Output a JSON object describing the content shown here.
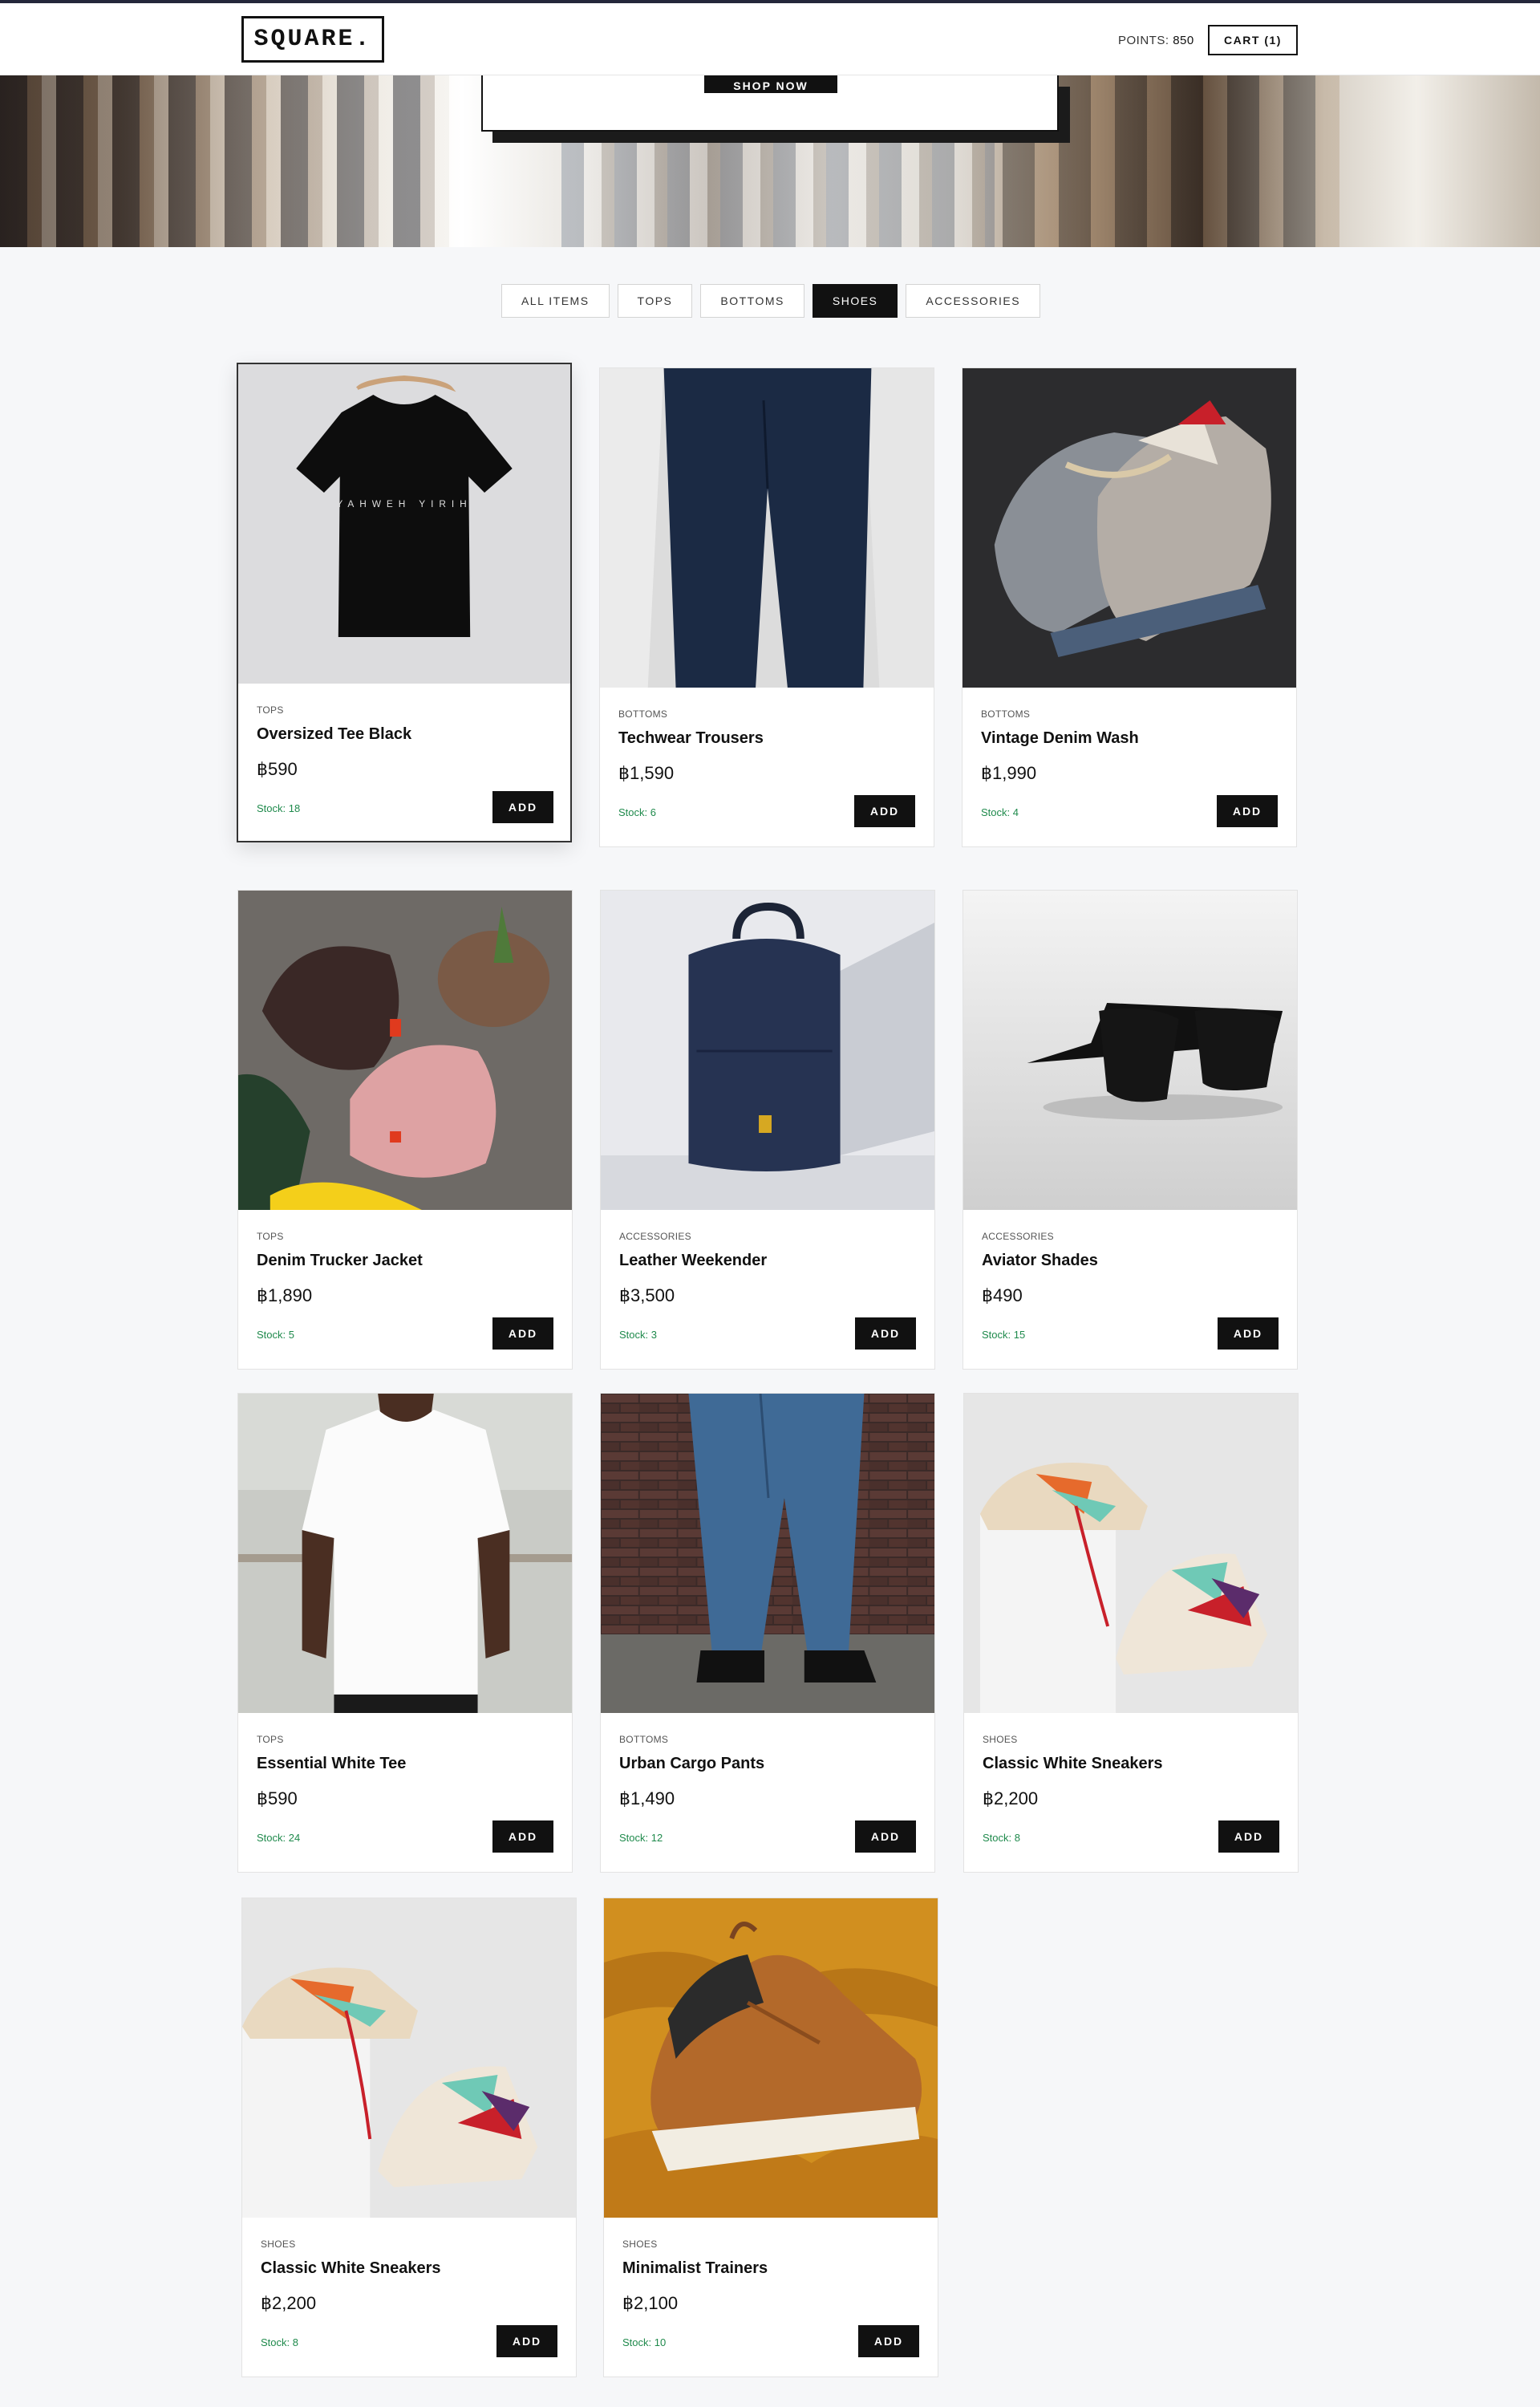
{
  "header": {
    "logo": "SQUARE.",
    "points_label": "POINTS:",
    "points_value": "850",
    "cart_label": "CART (1)"
  },
  "hero": {
    "cta_label": "SHOP NOW"
  },
  "filters": [
    {
      "label": "ALL ITEMS",
      "active": false
    },
    {
      "label": "TOPS",
      "active": false
    },
    {
      "label": "BOTTOMS",
      "active": false
    },
    {
      "label": "SHOES",
      "active": true
    },
    {
      "label": "ACCESSORIES",
      "active": false
    }
  ],
  "products": [
    {
      "category": "TOPS",
      "name": "Oversized Tee Black",
      "price": "฿590",
      "stock": "Stock: 18",
      "add_label": "ADD",
      "image": "black-tshirt-image"
    },
    {
      "category": "BOTTOMS",
      "name": "Techwear Trousers",
      "price": "฿1,590",
      "stock": "Stock: 6",
      "add_label": "ADD",
      "image": "navy-trousers-image"
    },
    {
      "category": "BOTTOMS",
      "name": "Vintage Denim Wash",
      "price": "฿1,990",
      "stock": "Stock: 4",
      "add_label": "ADD",
      "image": "grey-sneakers-image"
    },
    {
      "category": "TOPS",
      "name": "Denim Trucker Jacket",
      "price": "฿1,890",
      "stock": "Stock: 5",
      "add_label": "ADD",
      "image": "beanies-image"
    },
    {
      "category": "ACCESSORIES",
      "name": "Leather Weekender",
      "price": "฿3,500",
      "stock": "Stock: 3",
      "add_label": "ADD",
      "image": "backpack-image"
    },
    {
      "category": "ACCESSORIES",
      "name": "Aviator Shades",
      "price": "฿490",
      "stock": "Stock: 15",
      "add_label": "ADD",
      "image": "sunglasses-image"
    },
    {
      "category": "TOPS",
      "name": "Essential White Tee",
      "price": "฿590",
      "stock": "Stock: 24",
      "add_label": "ADD",
      "image": "white-tshirt-image"
    },
    {
      "category": "BOTTOMS",
      "name": "Urban Cargo Pants",
      "price": "฿1,490",
      "stock": "Stock: 12",
      "add_label": "ADD",
      "image": "jeans-image"
    },
    {
      "category": "SHOES",
      "name": "Classic White Sneakers",
      "price": "฿2,200",
      "stock": "Stock: 8",
      "add_label": "ADD",
      "image": "colorful-sneakers-image"
    },
    {
      "category": "SHOES",
      "name": "Classic White Sneakers",
      "price": "฿2,200",
      "stock": "Stock: 8",
      "add_label": "ADD",
      "image": "colorful-sneakers-image"
    },
    {
      "category": "SHOES",
      "name": "Minimalist Trainers",
      "price": "฿2,100",
      "stock": "Stock: 10",
      "add_label": "ADD",
      "image": "tan-sneaker-image"
    }
  ]
}
